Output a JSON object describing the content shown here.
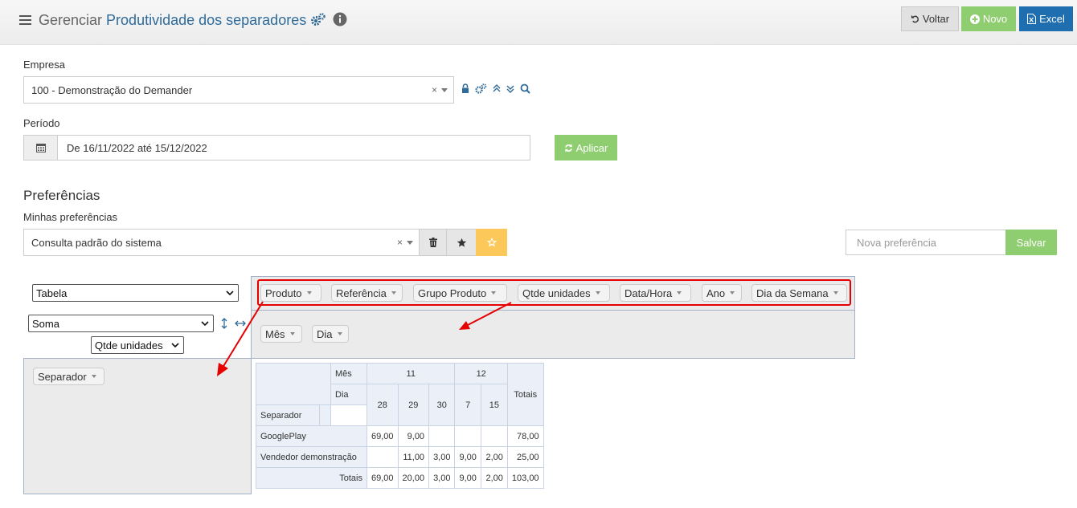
{
  "header": {
    "title_prefix": "Gerenciar",
    "title_main": "Produtividade dos separadores",
    "buttons": {
      "voltar": "Voltar",
      "novo": "Novo",
      "excel": "Excel"
    }
  },
  "empresa": {
    "label": "Empresa",
    "value": "100 - Demonstração do Demander",
    "clear": "×"
  },
  "periodo": {
    "label": "Período",
    "value": "De 16/11/2022 até 15/12/2022",
    "apply": "Aplicar"
  },
  "preferencias": {
    "title": "Preferências",
    "label": "Minhas preferências",
    "value": "Consulta padrão do sistema",
    "clear": "×",
    "new_placeholder": "Nova preferência",
    "save": "Salvar"
  },
  "pivot": {
    "renderer": "Tabela",
    "aggregator": "Soma",
    "aggregator_field": "Qtde unidades",
    "unused_attrs": [
      "Produto",
      "Referência",
      "Grupo Produto",
      "Qtde unidades",
      "Data/Hora",
      "Ano",
      "Dia da Semana"
    ],
    "col_attrs": [
      "Mês",
      "Dia"
    ],
    "row_attrs": [
      "Separador"
    ],
    "table": {
      "mes_label": "Mês",
      "dia_label": "Dia",
      "row_label": "Separador",
      "totals_label": "Totais",
      "months": [
        {
          "label": "11",
          "span": 3
        },
        {
          "label": "12",
          "span": 2
        }
      ],
      "days": [
        "28",
        "29",
        "30",
        "7",
        "15"
      ],
      "rows": [
        {
          "label": "GooglePlay",
          "values": [
            "69,00",
            "9,00",
            "",
            "",
            ""
          ],
          "total": "78,00"
        },
        {
          "label": "Vendedor demonstração",
          "values": [
            "",
            "11,00",
            "3,00",
            "9,00",
            "2,00"
          ],
          "total": "25,00"
        }
      ],
      "col_totals": [
        "69,00",
        "20,00",
        "3,00",
        "9,00",
        "2,00"
      ],
      "grand_total": "103,00"
    }
  },
  "colors": {
    "accent": "#2f6b9a",
    "green": "#8fce70",
    "blue": "#1f6fb0",
    "annotation_red": "#e60000",
    "star_yellow": "#fcc85a"
  }
}
